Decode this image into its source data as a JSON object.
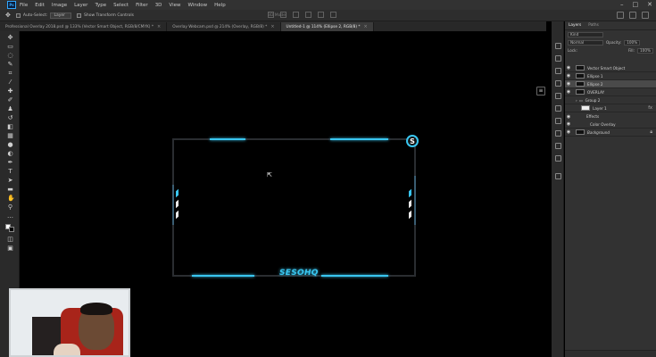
{
  "menubar": {
    "logo": "Ps",
    "items": [
      "File",
      "Edit",
      "Image",
      "Layer",
      "Type",
      "Select",
      "Filter",
      "3D",
      "View",
      "Window",
      "Help"
    ],
    "window_controls": [
      "–",
      "□",
      "✕"
    ]
  },
  "options": {
    "auto_select_label": "Auto-Select:",
    "auto_select_value": "Layer",
    "transform_label": "Show Transform Controls",
    "mode_3d": "3D Mode:"
  },
  "tabs": [
    {
      "label": "Professional Overlay 2018.psd @ 133% (Vector Smart Object, RGB/8/CMYK) *",
      "active": false
    },
    {
      "label": "Overlay Webcam.psd @ 214% (Overlay, RGB/8) *",
      "active": false
    },
    {
      "label": "Untitled-1 @ 114% (Ellipse 2, RGB/8) *",
      "active": true
    }
  ],
  "tab_close": "×",
  "canvas": {
    "brand_text": "SESOHQ",
    "logo_letter": "S",
    "accent": "#39c6f0",
    "secondary_accent": "#e9e9e9"
  },
  "layers_panel": {
    "tabs": [
      "Layers",
      "Paths"
    ],
    "kind_label": "Kind",
    "blend_mode": "Normal",
    "opacity_label": "Opacity:",
    "opacity": "100%",
    "lock_label": "Lock:",
    "fill_label": "Fill:",
    "fill": "100%",
    "layers": [
      {
        "name": "Vector Smart Object",
        "thumb": "dark",
        "selected": false
      },
      {
        "name": "Ellipse 1",
        "thumb": "dark",
        "selected": false
      },
      {
        "name": "Ellipse 2",
        "thumb": "dark",
        "selected": true
      },
      {
        "name": "OVERLAY",
        "thumb": "dark",
        "selected": false
      },
      {
        "name": "Group 2",
        "thumb": "folder",
        "selected": false
      },
      {
        "name": "Layer 1",
        "thumb": "white",
        "selected": false
      },
      {
        "name": "Effects",
        "thumb": "none",
        "selected": false
      },
      {
        "name": "Color Overlay",
        "thumb": "none",
        "selected": false
      },
      {
        "name": "Background",
        "thumb": "dark",
        "selected": false
      }
    ]
  }
}
